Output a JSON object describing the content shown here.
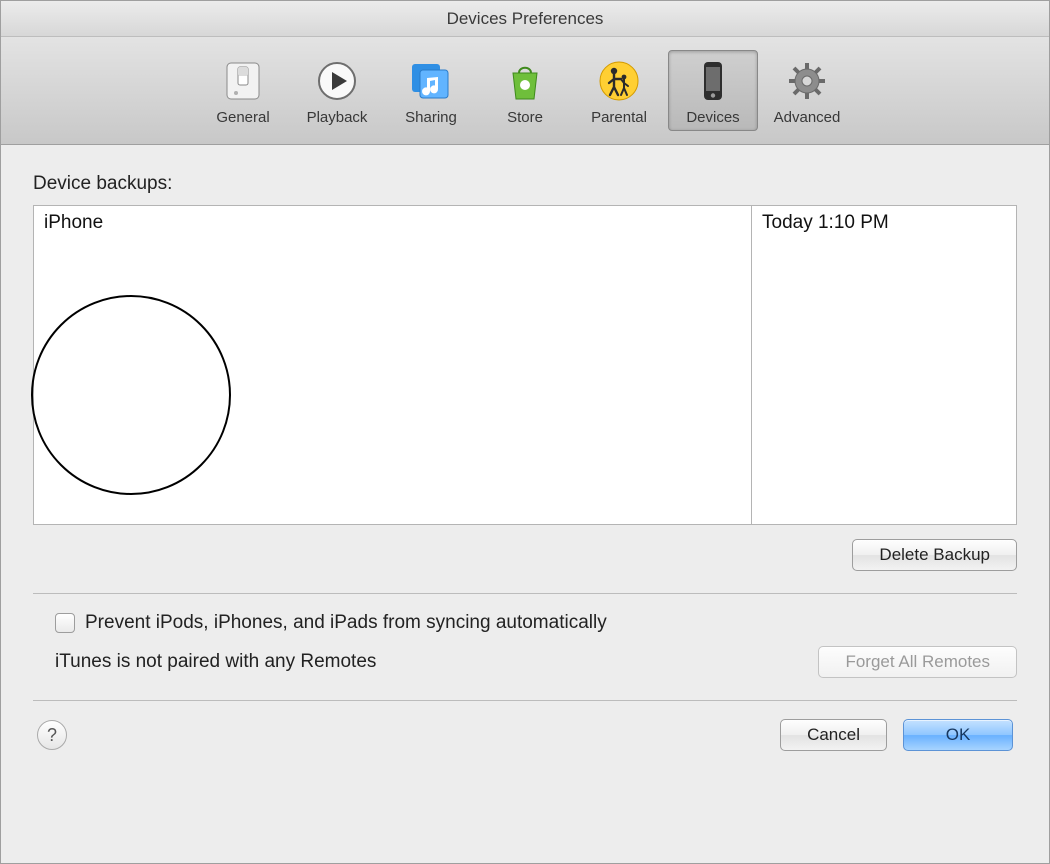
{
  "window": {
    "title": "Devices Preferences"
  },
  "toolbar": {
    "items": [
      {
        "label": "General"
      },
      {
        "label": "Playback"
      },
      {
        "label": "Sharing"
      },
      {
        "label": "Store"
      },
      {
        "label": "Parental"
      },
      {
        "label": "Devices"
      },
      {
        "label": "Advanced"
      }
    ]
  },
  "main": {
    "backups_label": "Device backups:",
    "backups": [
      {
        "name": "iPhone",
        "time": "Today 1:10 PM"
      }
    ],
    "delete_backup_label": "Delete Backup",
    "prevent_sync_label": "Prevent iPods, iPhones, and iPads from syncing automatically",
    "remotes_status": "iTunes is not paired with any Remotes",
    "forget_remotes_label": "Forget All Remotes"
  },
  "footer": {
    "help_glyph": "?",
    "cancel_label": "Cancel",
    "ok_label": "OK"
  }
}
